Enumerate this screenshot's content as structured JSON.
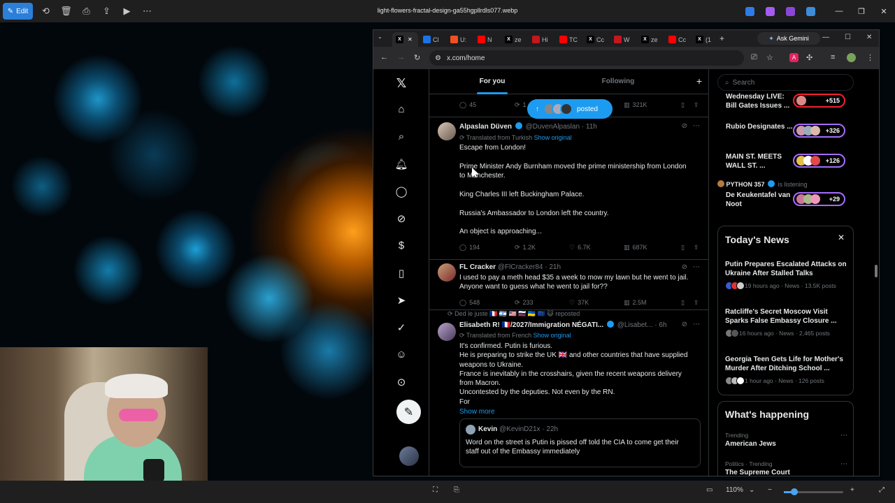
{
  "viewer": {
    "edit_label": "Edit",
    "title": "light-flowers-fractal-design-ga55hgpllrdls077.webp",
    "zoom": "110%"
  },
  "browser": {
    "tabs": [
      {
        "favicon": "x-icon",
        "label": "",
        "color": "#000000"
      },
      {
        "favicon": "upi-icon",
        "label": "Cl",
        "color": "#1a73e8"
      },
      {
        "favicon": "orange-icon",
        "label": "U:",
        "color": "#f25022"
      },
      {
        "favicon": "red-icon",
        "label": "N",
        "color": "#ff0000"
      },
      {
        "favicon": "x-icon",
        "label": "ze",
        "color": "#000000"
      },
      {
        "favicon": "house-icon",
        "label": "Hi",
        "color": "#c4161c"
      },
      {
        "favicon": "youtube-icon",
        "label": "TC",
        "color": "#ff0000"
      },
      {
        "favicon": "x-icon",
        "label": "Cc",
        "color": "#000000"
      },
      {
        "favicon": "red-icon",
        "label": "W",
        "color": "#c4161c"
      },
      {
        "favicon": "x-icon",
        "label": "ze",
        "color": "#000000"
      },
      {
        "favicon": "youtube-icon",
        "label": "Cc",
        "color": "#ff0000"
      },
      {
        "favicon": "x-icon",
        "label": "(1",
        "color": "#000000"
      }
    ],
    "gemini_label": "Ask Gemini",
    "url": "x.com/home"
  },
  "feed": {
    "tabs": {
      "for_you": "For you",
      "following": "Following"
    },
    "posted_label": "posted",
    "prev_actions": {
      "replies": "45",
      "reposts": "1",
      "views": "321K"
    },
    "tweets": [
      {
        "name": "Alpaslan Düven",
        "handle": "@DuvenAlpaslan",
        "time": "· 11h",
        "translated": "Translated from Turkish",
        "show_original": "Show original",
        "lines": [
          "Escape from London!",
          "Prime Minister Andy Burnham moved the prime ministership from London",
          "to Manchester.",
          "King Charles III left Buckingham Palace.",
          "Russia's Ambassador to London left the country.",
          "An object is approaching..."
        ],
        "replies": "194",
        "reposts": "1.2K",
        "likes": "6.7K",
        "views": "687K"
      },
      {
        "name": "FL Cracker",
        "handle": "@FlCracker84",
        "time": "· 21h",
        "lines": [
          "I used to pay a meth head $35 a week to mow my lawn but he went to jail.",
          "Anyone want to guess what he went to jail for??"
        ],
        "replies": "548",
        "reposts": "233",
        "likes": "37K",
        "views": "2.5M"
      },
      {
        "reposted_by": "Ded le juste 🇫🇷 🇮🇱 🇺🇸 🇷🇺 🇺🇦 🇪🇺 😺 reposted",
        "name": "Elisabeth R! 🇫🇷/2027/Immigration NÉGATI...",
        "handle": "@Lisabet...",
        "time": "· 6h",
        "translated": "Translated from French",
        "show_original": "Show original",
        "lines": [
          "It's confirmed. Putin is furious.",
          "He is preparing to strike the UK 🇬🇧 and other countries that have supplied",
          "weapons to Ukraine.",
          "France is inevitably in the crosshairs, given the recent weapons delivery",
          "from Macron.",
          "Uncontested by the deputies. Not even by the RN.",
          "For"
        ],
        "show_more": "Show more",
        "quote": {
          "name": "Kevin",
          "handle": "@KevinD21x",
          "time": "· 22h",
          "lines": [
            "Word on the street is Putin is pissed off  told the CIA to come get their",
            "staff out of the Embassy immediately"
          ]
        }
      }
    ]
  },
  "sidebar": {
    "search_placeholder": "Search",
    "spaces": [
      {
        "title": "Wednesday LIVE: Bill Gates Issues ...",
        "count": "+515"
      },
      {
        "title": "Rubio Designates ...",
        "count": "+326"
      },
      {
        "title": "MAIN ST. MEETS WALL ST. ...",
        "count": "+126"
      },
      {
        "title": "De Keukentafel van Noot",
        "count": "+29"
      }
    ],
    "listening": {
      "name": "PYTHON 357",
      "status": "is listening"
    },
    "todays_news": {
      "title": "Today's News",
      "items": [
        {
          "title": "Putin Prepares Escalated Attacks on Ukraine After Stalled Talks",
          "meta": "19 hours ago · News · 13.5K posts"
        },
        {
          "title": "Ratcliffe's Secret Moscow Visit Sparks False Embassy Closure ...",
          "meta": "16 hours ago · News · 2,465 posts"
        },
        {
          "title": "Georgia Teen Gets Life for Mother's Murder After Ditching School ...",
          "meta": "1 hour ago · News · 126 posts"
        }
      ]
    },
    "whats_happening": {
      "title": "What's happening",
      "items": [
        {
          "category": "Trending",
          "title": "American Jews"
        },
        {
          "category": "Politics · Trending",
          "title": "The Supreme Court"
        }
      ]
    }
  }
}
